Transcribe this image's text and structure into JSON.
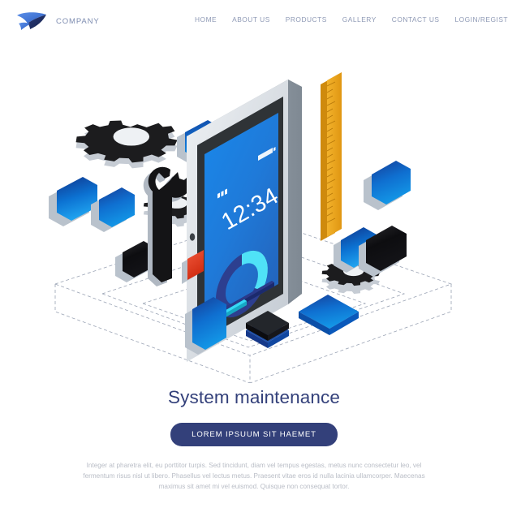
{
  "header": {
    "brand_name": "COMPANY",
    "logo_icon": "wing-logo-icon",
    "nav_items": [
      {
        "label": "HOME"
      },
      {
        "label": "ABOUT US"
      },
      {
        "label": "PRODUCTS"
      },
      {
        "label": "GALLERY"
      },
      {
        "label": "CONTACT US"
      },
      {
        "label": "LOGIN/REGISTER"
      }
    ]
  },
  "illustration": {
    "alt": "isometric smartphone system maintenance illustration",
    "phone": {
      "time": "12:34",
      "signal_icon": "signal-bars-icon",
      "battery_icon": "battery-icon",
      "donut": {
        "track_color": "#2f3f8c",
        "value_color": "#4fe2f7",
        "value_percent": 30
      },
      "progress_bars": [
        {
          "color": "#2b3a8a",
          "percent": 72
        },
        {
          "color": "#35d9f5",
          "percent": 45
        }
      ],
      "screen_gradient_from": "#1f7fe0",
      "screen_gradient_to": "#2a6fd4"
    },
    "objects": [
      {
        "name": "gear-large-icon",
        "color": "#1b1b1b"
      },
      {
        "name": "gear-small-icon",
        "color": "#1b1b1b"
      },
      {
        "name": "gear-right-icon",
        "color": "#1b1b1b"
      },
      {
        "name": "wrench-icon",
        "color": "#141414"
      },
      {
        "name": "ruler-icon",
        "color": "#efa71d"
      },
      {
        "name": "tile-blue",
        "color": "#0b74d6"
      },
      {
        "name": "tile-black",
        "color": "#121212"
      },
      {
        "name": "tile-red",
        "color": "#e33b20"
      }
    ],
    "accent_colors": {
      "blue": "#0b74d6",
      "deep_blue": "#1b3a8f",
      "cyan": "#35d9f5",
      "orange": "#efa71d",
      "red": "#e33b20",
      "navy": "#33407a"
    }
  },
  "content": {
    "headline": "System maintenance",
    "cta_label": "LOREM IPSUUM SIT HAEMET",
    "body": "Integer at pharetra elit, eu porttitor turpis. Sed tincidunt, diam vel tempus egestas, metus nunc consectetur leo, vel fermentum risus nisl ut libero. Phasellus vel lectus metus. Praesent vitae eros id nulla lacinia ullamcorper. Maecenas maximus sit amet mi vel euismod. Quisque non consequat tortor."
  }
}
